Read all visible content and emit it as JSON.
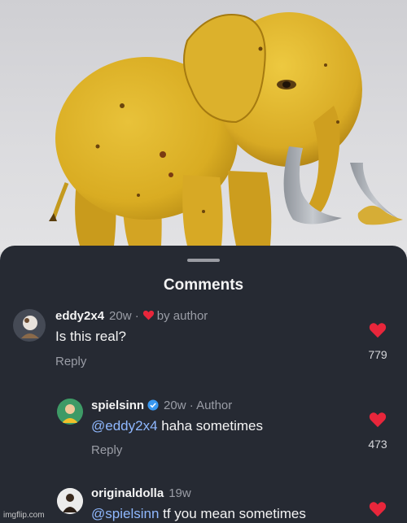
{
  "image": {
    "subject": "banana-elephant"
  },
  "sheet": {
    "title": "Comments"
  },
  "comments": [
    {
      "username": "eddy2x4",
      "time": "20w",
      "separator": "·",
      "liked_by_label": "by author",
      "text": "Is this real?",
      "reply_label": "Reply",
      "likes": "779"
    },
    {
      "username": "spielsinn",
      "time": "20w",
      "separator": "·",
      "author_label": "Author",
      "mention": "@eddy2x4",
      "text": " haha sometimes",
      "reply_label": "Reply",
      "likes": "473"
    },
    {
      "username": "originaldolla",
      "time": "19w",
      "mention": "@spielsinn",
      "text": " tf you mean sometimes"
    }
  ],
  "colors": {
    "sheet_bg": "#262a33",
    "heart": "#e8263b",
    "mention": "#8fb8ff",
    "verified": "#3897f0"
  },
  "watermark": "imgflip.com"
}
